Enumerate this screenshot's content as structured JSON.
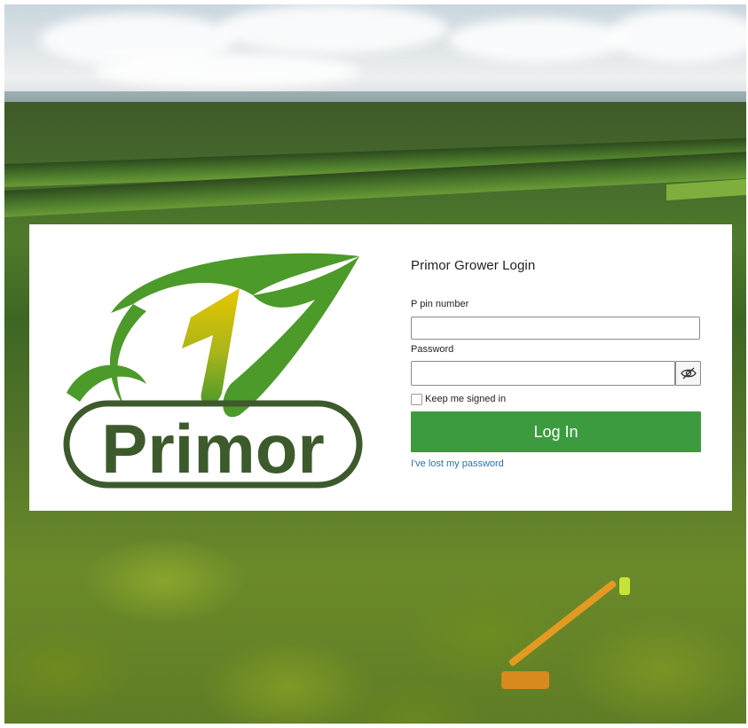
{
  "login": {
    "title": "Primor Grower Login",
    "pin_label": "P pin number",
    "pin_value": "",
    "password_label": "Password",
    "password_value": "",
    "show_password_icon": "eye-slash-icon",
    "remember_label": "Keep me signed in",
    "remember_checked": false,
    "submit_label": "Log In",
    "lost_password_link": "I've lost my password"
  },
  "brand": {
    "name": "Primor",
    "colors": {
      "leaf_green": "#4c9a2a",
      "leaf_yellow": "#e3c400",
      "logo_dark": "#3d5a2c",
      "button_green": "#3c9b3f",
      "link_blue": "#2d6fb6"
    }
  }
}
